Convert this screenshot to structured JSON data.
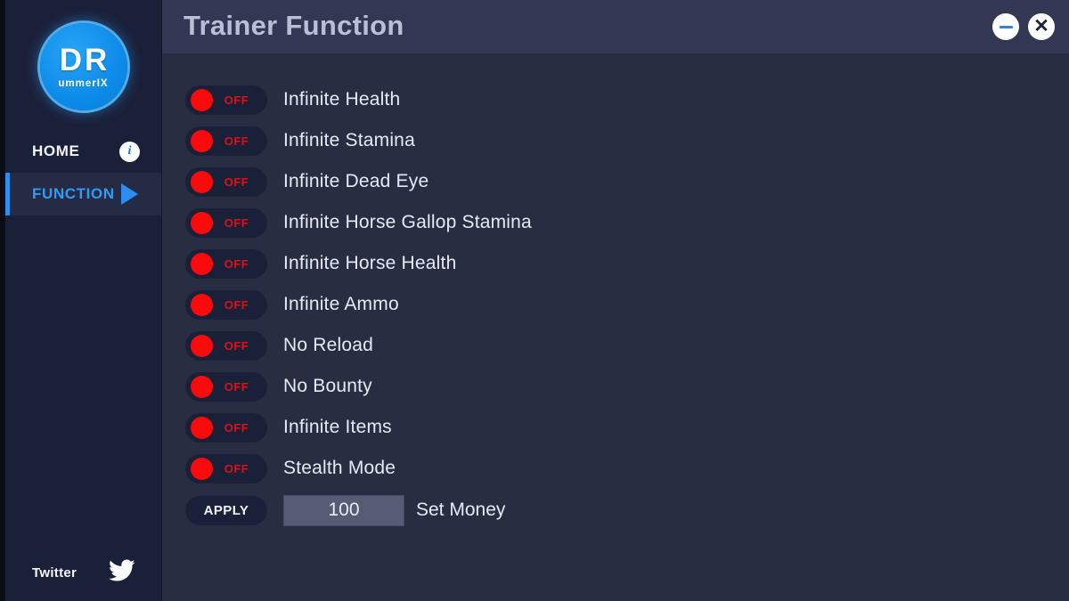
{
  "window": {
    "title": "Trainer Function",
    "minimize_label": "–",
    "close_label": "✕",
    "minimize_icon": "minimize-icon",
    "close_icon": "close-icon"
  },
  "colors": {
    "accent_blue": "#2e8df0",
    "toggle_red": "#fa0a0a",
    "off_text_red": "#e01018",
    "sidebar_bg": "#1b2039",
    "main_bg": "#282d42",
    "titlebar_bg": "#323854",
    "title_text": "#b9bfd4",
    "input_bg": "#555c74"
  },
  "sidebar": {
    "logo": {
      "main_text": "DR",
      "sub_text": "ummerIX"
    },
    "items": [
      {
        "label": "HOME",
        "icon": "info-icon",
        "active": false
      },
      {
        "label": "FUNCTION",
        "icon": "play-icon",
        "active": true
      }
    ],
    "social": {
      "label": "Twitter",
      "icon": "twitter-bird-icon"
    }
  },
  "functions": [
    {
      "label": "Infinite Health",
      "state": "OFF"
    },
    {
      "label": "Infinite Stamina",
      "state": "OFF"
    },
    {
      "label": "Infinite Dead Eye",
      "state": "OFF"
    },
    {
      "label": "Infinite Horse Gallop Stamina",
      "state": "OFF"
    },
    {
      "label": "Infinite Horse Health",
      "state": "OFF"
    },
    {
      "label": "Infinite Ammo",
      "state": "OFF"
    },
    {
      "label": "No Reload",
      "state": "OFF"
    },
    {
      "label": "No Bounty",
      "state": "OFF"
    },
    {
      "label": "Infinite Items",
      "state": "OFF"
    },
    {
      "label": "Stealth Mode",
      "state": "OFF"
    }
  ],
  "apply_row": {
    "button_label": "APPLY",
    "input_value": "100",
    "input_placeholder": "100",
    "label": "Set Money"
  }
}
